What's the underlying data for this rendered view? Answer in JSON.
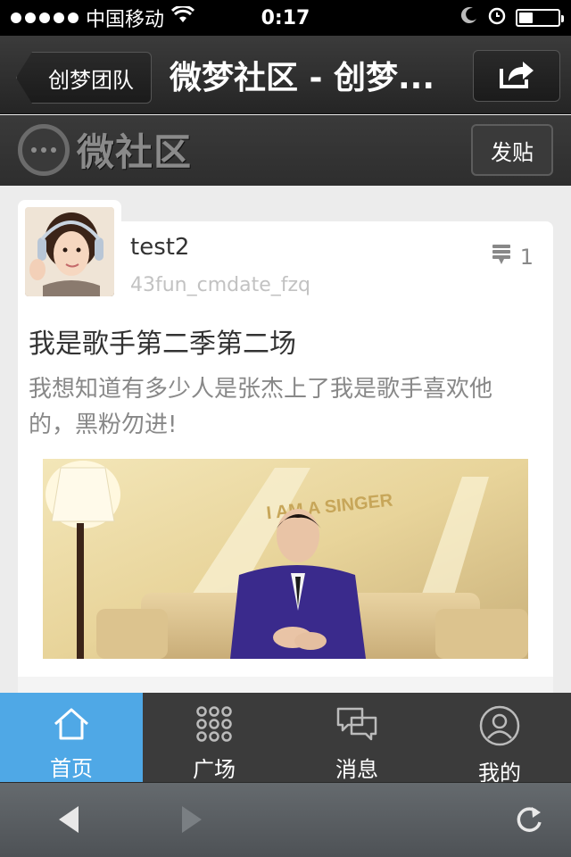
{
  "status_bar": {
    "carrier": "中国移动",
    "time": "0:17",
    "battery_level": 0.35
  },
  "nav": {
    "back_label": "创梦团队",
    "title": "微梦社区 - 创梦...",
    "share_icon": "share-icon"
  },
  "community": {
    "logo_text": "微社区",
    "post_button": "发贴"
  },
  "post": {
    "author_name": "test2",
    "author_id": "43fun_cmdate_fzq",
    "comment_count": "1",
    "title": "我是歌手第二季第二场",
    "body": "我想知道有多少人是张杰上了我是歌手喜欢他的，黑粉勿进!",
    "image_sign_text": "I AM A SINGER"
  },
  "tabs": [
    {
      "label": "首页",
      "icon": "home-icon",
      "active": true
    },
    {
      "label": "广场",
      "icon": "grid-icon",
      "active": false
    },
    {
      "label": "消息",
      "icon": "chat-icon",
      "active": false
    },
    {
      "label": "我的",
      "icon": "user-icon",
      "active": false
    }
  ],
  "colors": {
    "accent": "#4fa8e6",
    "dark_bar": "#3b3b3b"
  }
}
